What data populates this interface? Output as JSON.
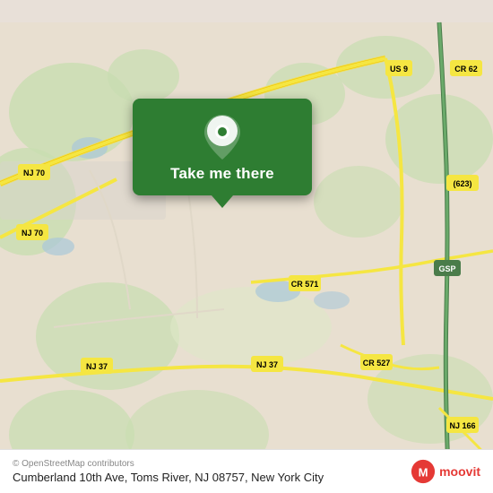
{
  "map": {
    "background_color": "#e8e0d8",
    "roads": [
      {
        "label": "NJ 70",
        "color": "#f5e642"
      },
      {
        "label": "NJ 37",
        "color": "#f5e642"
      },
      {
        "label": "US 9",
        "color": "#f5e642"
      },
      {
        "label": "CR 571",
        "color": "#f5e642"
      },
      {
        "label": "CR 527",
        "color": "#f5e642"
      },
      {
        "label": "CR 62",
        "color": "#f5e642"
      },
      {
        "label": "(623)",
        "color": "#f5e642"
      },
      {
        "label": "GSP",
        "color": "#009900"
      },
      {
        "label": "NJ 166",
        "color": "#f5e642"
      }
    ]
  },
  "popup": {
    "label": "Take me there",
    "background_color": "#2e7d32"
  },
  "bottom_bar": {
    "attribution": "© OpenStreetMap contributors",
    "address": "Cumberland 10th Ave, Toms River, NJ 08757, New York City",
    "logo_text": "moovit"
  }
}
